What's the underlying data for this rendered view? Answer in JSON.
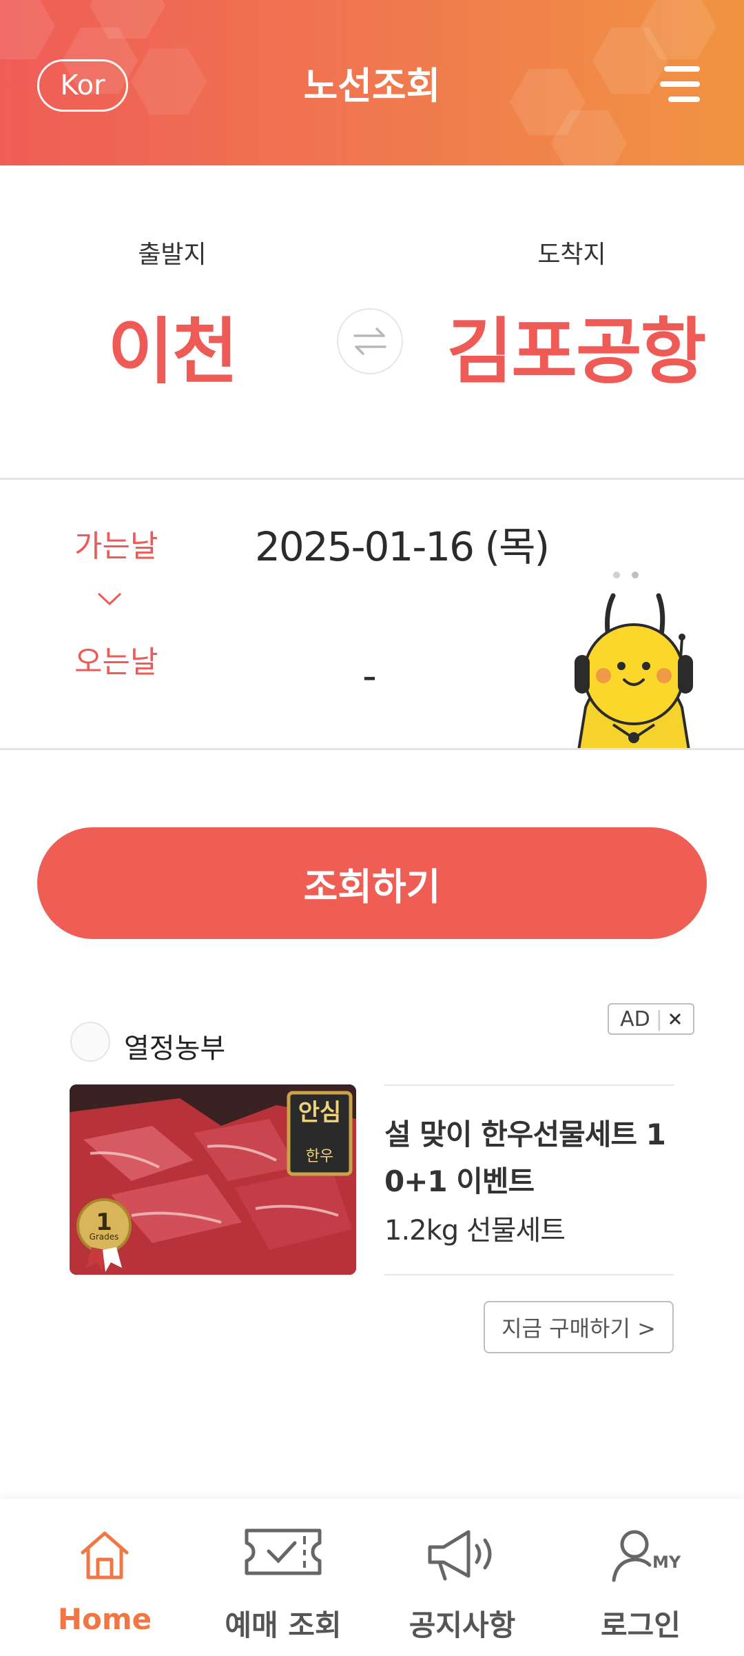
{
  "header": {
    "lang_button": "Kor",
    "title": "노선조회",
    "menu_icon": "hamburger-menu-icon"
  },
  "route": {
    "departure_label": "출발지",
    "departure_city": "이천",
    "arrival_label": "도착지",
    "arrival_city": "김포공항",
    "swap_icon": "swap-arrows-icon"
  },
  "dates": {
    "go_label": "가는날",
    "go_value": "2025-01-16 (목)",
    "return_label": "오는날",
    "return_value": "-"
  },
  "search_button": "조회하기",
  "ad": {
    "brand": "열정농부",
    "tag": "AD",
    "title": "설 맞이 한우선물세트 1 0+1 이벤트",
    "subtitle": "1.2kg 선물세트",
    "cta": "지금 구매하기 >",
    "image_badge": "1",
    "image_badge_caption": "Grades",
    "image_label_main": "안심",
    "image_label_small": "한우"
  },
  "bottom_nav": {
    "items": [
      {
        "label": "Home",
        "icon": "home-icon",
        "active": true
      },
      {
        "label": "예매 조회",
        "icon": "ticket-check-icon",
        "active": false
      },
      {
        "label": "공지사항",
        "icon": "megaphone-icon",
        "active": false
      },
      {
        "label": "로그인",
        "icon": "user-my-icon",
        "active": false
      }
    ],
    "my_badge": "MY"
  },
  "colors": {
    "accent": "#ee5a55",
    "header_start": "#ef5d57",
    "header_end": "#f19442",
    "nav_active": "#f07744"
  }
}
